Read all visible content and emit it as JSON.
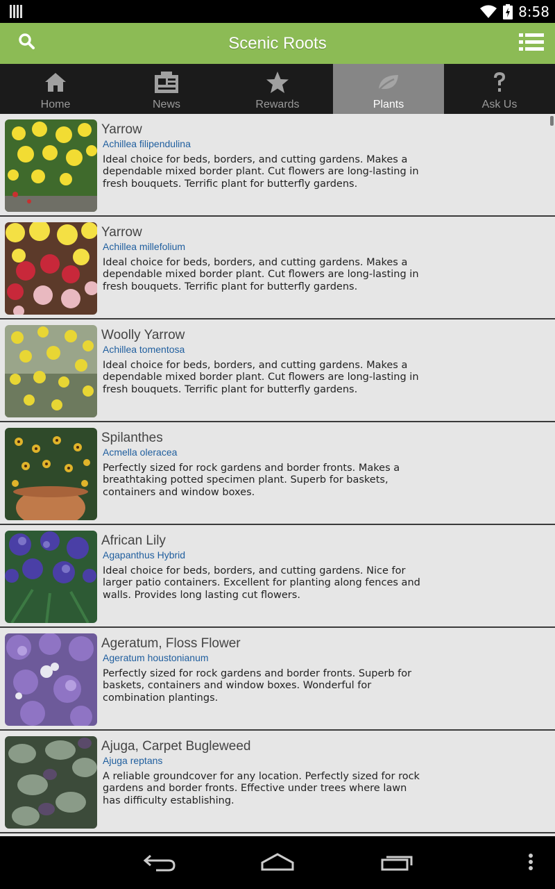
{
  "status_bar": {
    "time": "8:58",
    "icons": [
      "notification-icon",
      "wifi-icon",
      "battery-icon"
    ]
  },
  "app_bar": {
    "title": "Scenic Roots",
    "search_icon": "search-icon",
    "menu_icon": "list-menu-icon",
    "color": "#8cbb55"
  },
  "tabs": [
    {
      "label": "Home",
      "icon": "home-icon",
      "active": false
    },
    {
      "label": "News",
      "icon": "news-icon",
      "active": false
    },
    {
      "label": "Rewards",
      "icon": "star-icon",
      "active": false
    },
    {
      "label": "Plants",
      "icon": "leaf-icon",
      "active": true
    },
    {
      "label": "Ask Us",
      "icon": "question-icon",
      "active": false
    }
  ],
  "plants": [
    {
      "name": "Yarrow",
      "latin": "Achillea filipendulina",
      "desc": "Ideal choice for beds, borders, and cutting gardens. Makes a dependable mixed border plant. Cut flowers are long-lasting in fresh bouquets. Terrific plant for butterfly gardens.",
      "palette": [
        "#f2dc33",
        "#3f6a2c",
        "#c83030"
      ]
    },
    {
      "name": "Yarrow",
      "latin": "Achillea millefolium",
      "desc": "Ideal choice for beds, borders, and cutting gardens. Makes a dependable mixed border plant. Cut flowers are long-lasting in fresh bouquets. Terrific plant for butterfly gardens.",
      "palette": [
        "#f4e044",
        "#c8283a",
        "#e9b9c0"
      ]
    },
    {
      "name": "Woolly Yarrow",
      "latin": "Achillea tomentosa",
      "desc": "Ideal choice for beds, borders, and cutting gardens. Makes a dependable mixed border plant. Cut flowers are long-lasting in fresh bouquets. Terrific plant for butterfly gardens.",
      "palette": [
        "#e8d634",
        "#9aa58a",
        "#6d7a5e"
      ]
    },
    {
      "name": "Spilanthes",
      "latin": "Acmella oleracea",
      "desc": "Perfectly sized for rock gardens and border fronts. Makes a breathtaking potted specimen plant. Superb for baskets, containers and window boxes.",
      "palette": [
        "#e0b32a",
        "#2f4a2a",
        "#c07a4a"
      ]
    },
    {
      "name": "African Lily",
      "latin": "Agapanthus Hybrid",
      "desc": "Ideal choice for beds, borders, and cutting gardens. Nice for larger patio containers. Excellent for planting along fences and walls. Provides long lasting cut flowers.",
      "palette": [
        "#4a3fa6",
        "#2d5a34",
        "#7b73c8"
      ]
    },
    {
      "name": "Ageratum, Floss Flower",
      "latin": "Ageratum houstonianum",
      "desc": "Perfectly sized for rock gardens and border fronts. Superb for baskets, containers and window boxes. Wonderful for combination plantings.",
      "palette": [
        "#8f74c4",
        "#b59fe0",
        "#e8e8f0"
      ]
    },
    {
      "name": "Ajuga, Carpet Bugleweed",
      "latin": "Ajuga reptans",
      "desc": "A reliable groundcover for any location. Perfectly sized for rock gardens and border fronts. Effective under trees where lawn has difficulty establishing.",
      "palette": [
        "#3c4b3a",
        "#8a9b88",
        "#5a4a6a"
      ]
    }
  ],
  "nav_bar": {
    "buttons": [
      "back-icon",
      "home-nav-icon",
      "recents-icon",
      "overflow-icon"
    ]
  }
}
